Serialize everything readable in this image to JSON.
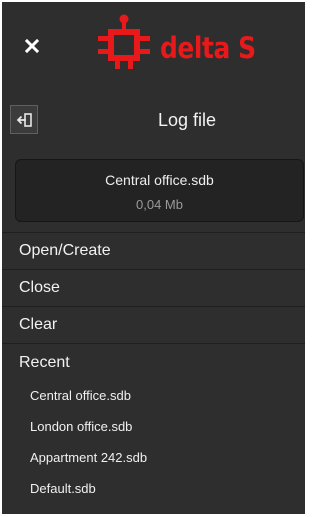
{
  "brand": {
    "logo_text": "delta S",
    "brand_color": "#e8191a"
  },
  "header": {
    "title": "Log file"
  },
  "current_file": {
    "name": "Central office.sdb",
    "size": "0,04 Mb"
  },
  "menu": {
    "open_create": "Open/Create",
    "close": "Close",
    "clear": "Clear"
  },
  "recent": {
    "header": "Recent",
    "items": [
      {
        "label": "Central office.sdb"
      },
      {
        "label": "London office.sdb"
      },
      {
        "label": "Appartment 242.sdb"
      },
      {
        "label": "Default.sdb"
      }
    ]
  },
  "colors": {
    "panel_bg": "#2e2e2e",
    "card_bg": "#232323",
    "text": "#f2f2f2",
    "muted_text": "#9a9a9a"
  },
  "icons": {
    "close": "close-icon",
    "back": "back-arrow-icon",
    "logo": "chip-logo-icon"
  }
}
